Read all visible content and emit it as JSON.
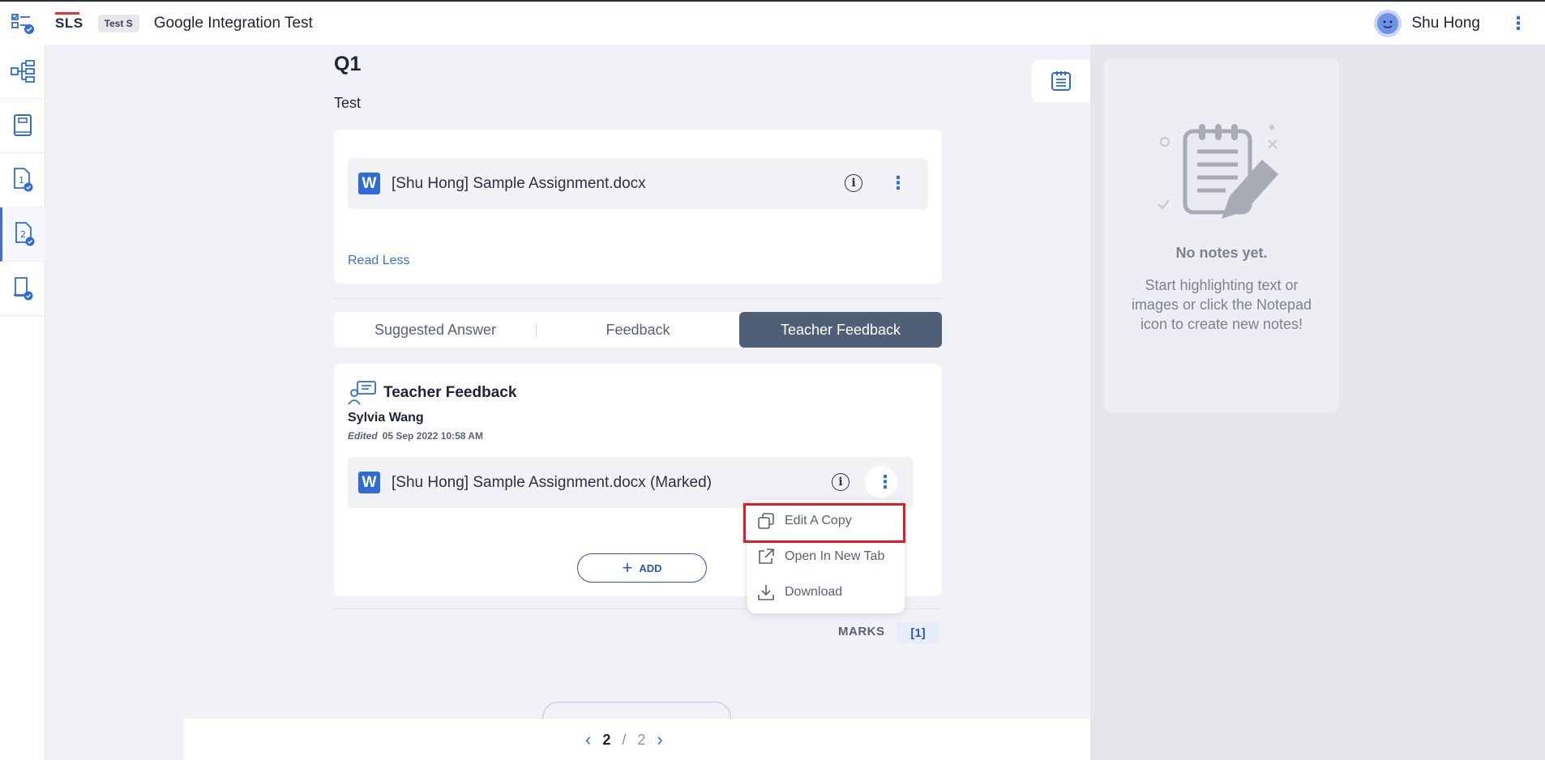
{
  "header": {
    "logo": "SLS",
    "chip": "Test S",
    "title": "Google Integration Test",
    "user_name": "Shu Hong"
  },
  "question": {
    "label": "Q1",
    "text": "Test",
    "attachment": "[Shu Hong] Sample Assignment.docx",
    "read_less": "Read Less"
  },
  "tabs": [
    {
      "label": "Suggested Answer"
    },
    {
      "label": "Feedback"
    },
    {
      "label": "Teacher Feedback",
      "active": true
    }
  ],
  "teacher_feedback": {
    "heading": "Teacher Feedback",
    "teacher": "Sylvia Wang",
    "edited_label": "Edited",
    "edited_time": "05 Sep 2022 10:58 AM",
    "attachment": "[Shu Hong] Sample Assignment.docx (Marked)",
    "add_label": "ADD"
  },
  "context_menu": [
    {
      "label": "Edit A Copy",
      "icon": "copy-icon"
    },
    {
      "label": "Open In New Tab",
      "icon": "external-link-icon"
    },
    {
      "label": "Download",
      "icon": "download-icon"
    }
  ],
  "marks": {
    "label": "MARKS",
    "value": "[1]"
  },
  "pager": {
    "current": "2",
    "separator": "/",
    "total": "2"
  },
  "notes": {
    "empty_title": "No notes yet.",
    "empty_text": "Start highlighting text or images or click the Notepad icon to create new notes!"
  },
  "colors": {
    "accent": "#2f6bd8",
    "active_tab": "#4f5f75",
    "highlight": "#e21d23"
  }
}
